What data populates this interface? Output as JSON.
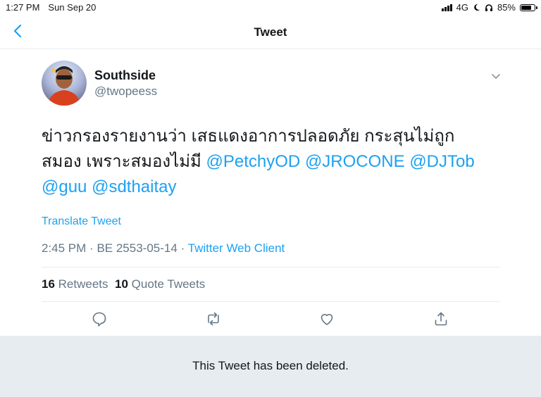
{
  "status_bar": {
    "time": "1:27 PM",
    "date": "Sun Sep 20",
    "network": "4G",
    "battery": "85%",
    "battery_level": 0.85,
    "icons": [
      "signal-icon",
      "moon-icon",
      "headphones-icon",
      "battery-icon"
    ]
  },
  "nav": {
    "title": "Tweet",
    "back_icon": "chevron-left-icon"
  },
  "tweet": {
    "author_name": "Southside",
    "author_handle": "@twopeess",
    "text_plain": "ข่าวกรองรายงานว่า เสธแดงอาการปลอดภัย กระสุนไม่ถูกสมอง เพราะสมองไม่มี ",
    "mentions": [
      "@PetchyOD",
      "@JROCONE",
      "@DJTob",
      "@guu",
      "@sdthaitay"
    ],
    "translate_label": "Translate Tweet",
    "time": "2:45 PM",
    "date": "BE 2553-05-14",
    "separator": "·",
    "client": "Twitter Web Client",
    "retweets_count": "16",
    "retweets_label": "Retweets",
    "quotes_count": "10",
    "quotes_label": "Quote Tweets"
  },
  "actions": [
    "reply-icon",
    "retweet-icon",
    "like-icon",
    "share-icon"
  ],
  "banner": {
    "text": "This Tweet has been deleted."
  },
  "colors": {
    "accent": "#1da1f2",
    "secondary_text": "#657786",
    "banner_bg": "#e6ecf0"
  }
}
